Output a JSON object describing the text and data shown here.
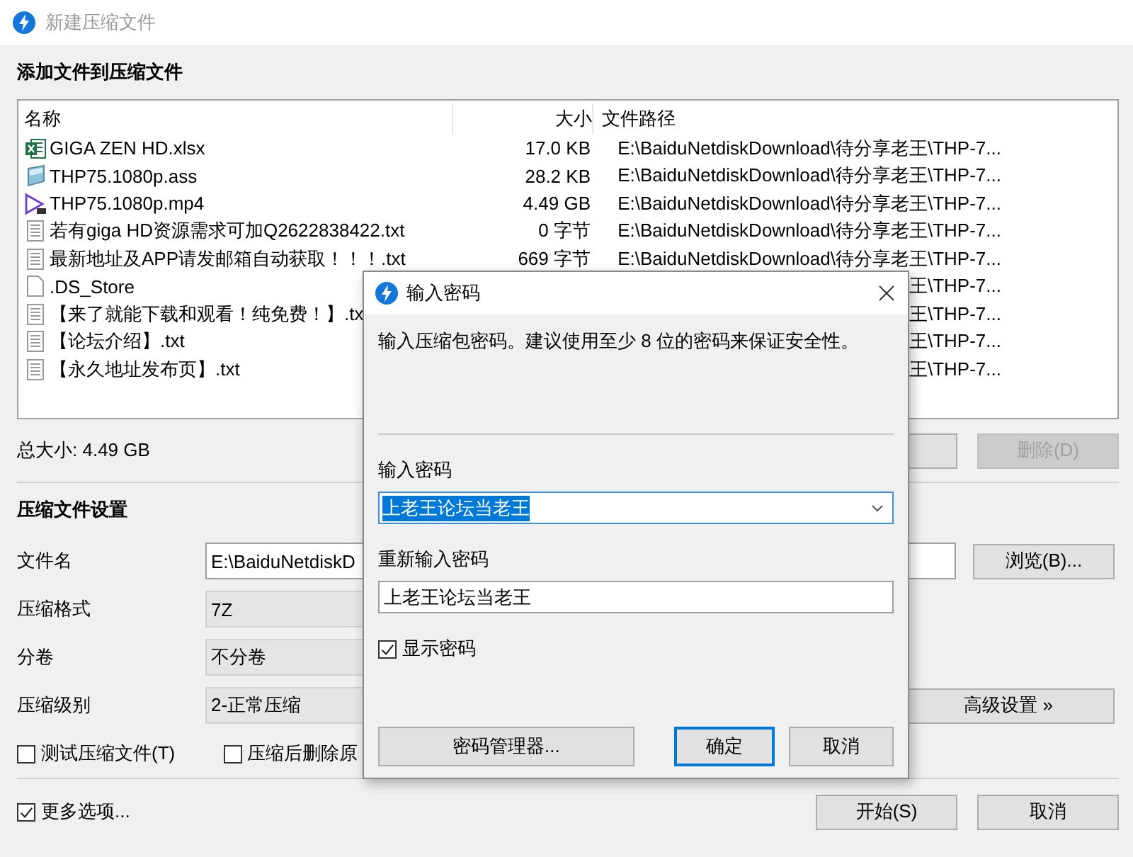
{
  "window": {
    "title": "新建压缩文件"
  },
  "files": {
    "title": "添加文件到压缩文件",
    "columns": [
      "名称",
      "大小",
      "文件路径"
    ],
    "rows": [
      {
        "kind": "sheet",
        "name": "GIGA ZEN HD.xlsx",
        "size": "17.0 KB",
        "path": "E:\\BaiduNetdiskDownload\\待分享老王\\THP-7..."
      },
      {
        "kind": "subtitle",
        "name": "THP75.1080p.ass",
        "size": "28.2 KB",
        "path": "E:\\BaiduNetdiskDownload\\待分享老王\\THP-7..."
      },
      {
        "kind": "video",
        "name": "THP75.1080p.mp4",
        "size": "4.49 GB",
        "path": "E:\\BaiduNetdiskDownload\\待分享老王\\THP-7..."
      },
      {
        "kind": "text",
        "name": "若有giga HD资源需求可加Q2622838422.txt",
        "size": "0 字节",
        "path": "E:\\BaiduNetdiskDownload\\待分享老王\\THP-7..."
      },
      {
        "kind": "text",
        "name": "最新地址及APP请发邮箱自动获取！！！.txt",
        "size": "669 字节",
        "path": "E:\\BaiduNetdiskDownload\\待分享老王\\THP-7..."
      },
      {
        "kind": "blank",
        "name": ".DS_Store",
        "path": "王\\THP-7..."
      },
      {
        "kind": "text",
        "name": "【来了就能下载和观看！纯免费！】.tx",
        "path": "王\\THP-7..."
      },
      {
        "kind": "text",
        "name": "【论坛介绍】.txt",
        "path": "王\\THP-7..."
      },
      {
        "kind": "text",
        "name": "【永久地址发布页】.txt",
        "path": "王\\THP-7..."
      }
    ],
    "total": "总大小: 4.49 GB",
    "delete_button": {
      "label": "删除(D)",
      "disabled": true
    }
  },
  "settings": {
    "title": "压缩文件设置",
    "filename": {
      "label": "文件名",
      "value": "E:\\BaiduNetdiskD"
    },
    "browse_button": "浏览(B)...",
    "format": {
      "label": "压缩格式",
      "value": "7Z"
    },
    "volume": {
      "label": "分卷",
      "value": "不分卷"
    },
    "level": {
      "label": "压缩级别",
      "value": "2-正常压缩"
    },
    "advanced_button": "高级设置 »",
    "checkboxes": [
      {
        "label": "测试压缩文件(T)",
        "checked": false
      },
      {
        "label": "压缩后删除原",
        "checked": false
      }
    ],
    "more_options": {
      "label": "更多选项...",
      "checked": true
    },
    "buttons": [
      "开始(S)",
      "取消"
    ]
  },
  "dialog": {
    "title": "输入密码",
    "description": "输入压缩包密码。建议使用至少 8 位的密码来保证安全性。",
    "password_label": "输入密码",
    "password": {
      "value": "上老王论坛当老王",
      "text_selected": true
    },
    "confirm_label": "重新输入密码",
    "confirm": {
      "value": "上老王论坛当老王"
    },
    "show_password": {
      "label": "显示密码",
      "checked": true
    },
    "buttons": [
      {
        "label": "密码管理器...",
        "default": false
      },
      {
        "label": "确定",
        "default": true
      },
      {
        "label": "取消",
        "default": false
      }
    ]
  }
}
